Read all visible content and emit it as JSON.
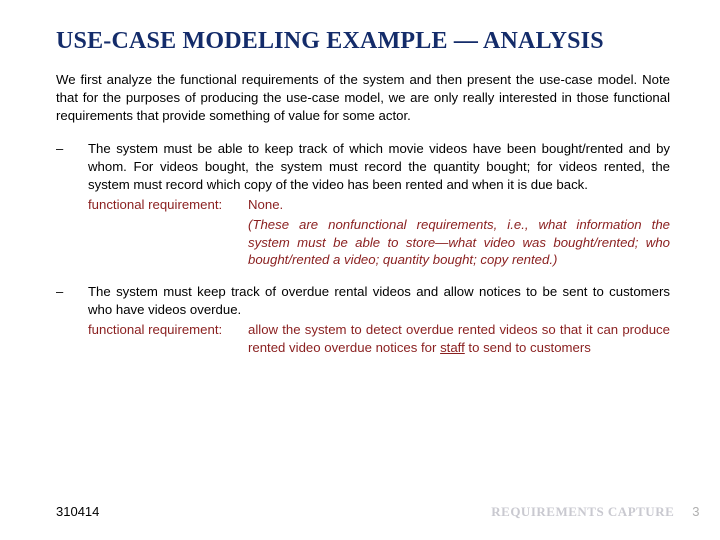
{
  "title": "USE-CASE MODELING EXAMPLE — ANALYSIS",
  "intro": "We first analyze the functional requirements of the system and then present the use-case model. Note that for the purposes of producing the use-case model, we are only really interested in those functional requirements that provide something of value for some actor.",
  "bullets": [
    {
      "text": "The system must be able to keep track of which movie videos have been bought/rented and by whom. For videos bought, the system must record the quantity bought; for videos rented, the system must record which copy of the video has been rented and when it is due back.",
      "fr_label": "functional requirement:",
      "fr_value_plain": "None.",
      "fr_value_italic": "(These are nonfunctional requirements, i.e., what information the system must be able to store—what video was bought/rented; who bought/rented a video; quantity bought; copy rented.)"
    },
    {
      "text": "The system must keep track of overdue rental videos and allow notices to be sent to customers who have videos overdue.",
      "fr_label": "functional requirement:",
      "fr_value_pre": "allow the system to detect overdue rented videos so that it can produce rented video overdue notices for ",
      "fr_value_underline": "staff",
      "fr_value_post": " to send to customers"
    }
  ],
  "footer": {
    "left": "310414",
    "right": "REQUIREMENTS CAPTURE",
    "page": "3"
  }
}
